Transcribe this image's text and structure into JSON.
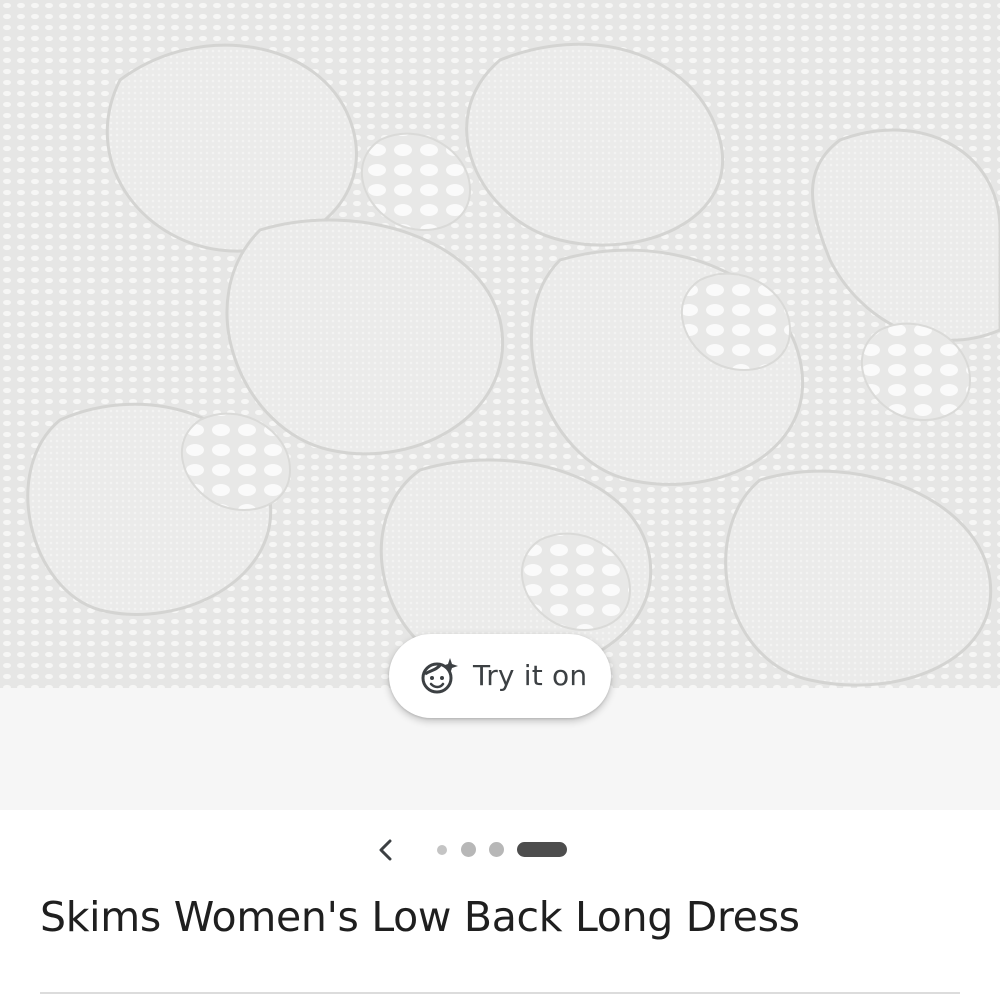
{
  "product_image": {
    "icon": "lace-fabric-image",
    "colors": {
      "background": "#e9e9e8",
      "lace": "#f7f7f6",
      "outline": "#d9d9d7"
    }
  },
  "try_on": {
    "label": "Try it on",
    "icon": "face-sparkle-icon"
  },
  "carousel": {
    "prev_icon": "chevron-left-icon",
    "page_count": 4,
    "active_index": 3
  },
  "product": {
    "title": "Skims Women's Low Back Long Dress"
  }
}
